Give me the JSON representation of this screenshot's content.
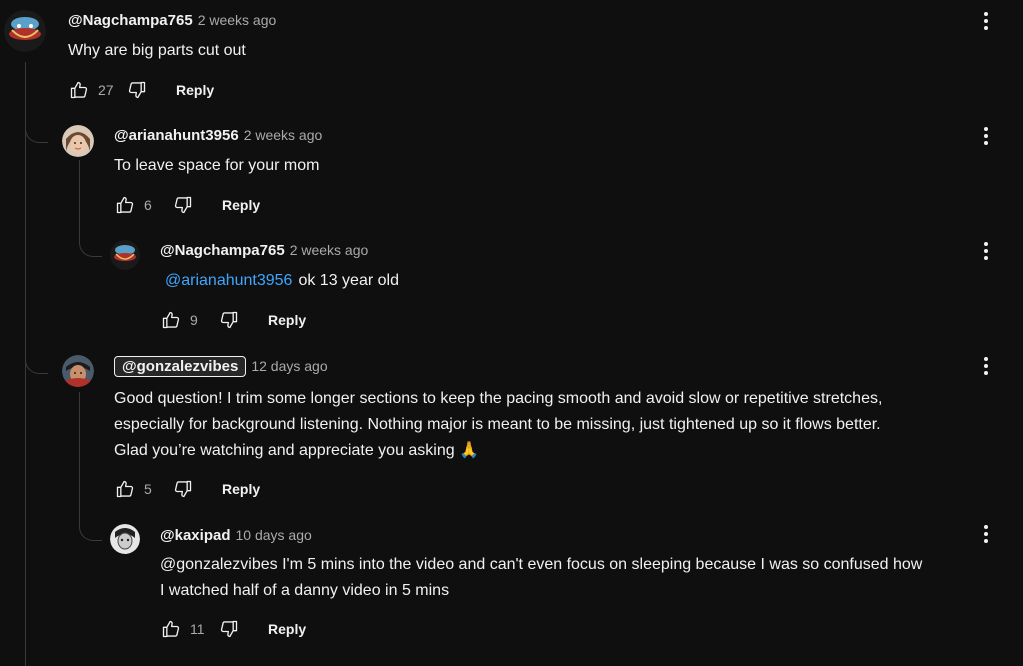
{
  "comments": [
    {
      "author": "@Nagchampa765",
      "time": "2 weeks ago",
      "lines": [
        "Why are big parts cut out"
      ],
      "likes": "27",
      "reply_label": "Reply"
    },
    {
      "author": "@arianahunt3956",
      "time": "2 weeks ago",
      "lines": [
        "To leave space for your mom"
      ],
      "likes": "6",
      "reply_label": "Reply"
    },
    {
      "author": "@Nagchampa765",
      "time": "2 weeks ago",
      "mention": "@arianahunt3956",
      "lines": [
        "ok 13 year old"
      ],
      "likes": "9",
      "reply_label": "Reply"
    },
    {
      "author": "@gonzalezvibes",
      "time": "12 days ago",
      "lines": [
        "Good question! I trim some longer sections to keep the pacing smooth and avoid slow or repetitive stretches,",
        "especially for background listening. Nothing major is meant to be missing, just tightened up so it flows better.",
        "Glad you’re watching and appreciate you asking 🙏"
      ],
      "likes": "5",
      "reply_label": "Reply"
    },
    {
      "author": "@kaxipad",
      "time": "10 days ago",
      "lines": [
        "@gonzalezvibes I'm 5 mins into the video and can't even focus on sleeping because I was so confused how",
        "I watched half of a danny video in 5 mins"
      ],
      "likes": "11",
      "reply_label": "Reply"
    }
  ],
  "icons": {
    "like": "thumbs-up-icon",
    "dislike": "thumbs-down-icon",
    "menu": "more-vertical-icon"
  },
  "colors": {
    "background": "#0f0f0f",
    "text": "#f1f1f1",
    "secondary": "#aaaaaa",
    "mention": "#3ea6ff"
  }
}
